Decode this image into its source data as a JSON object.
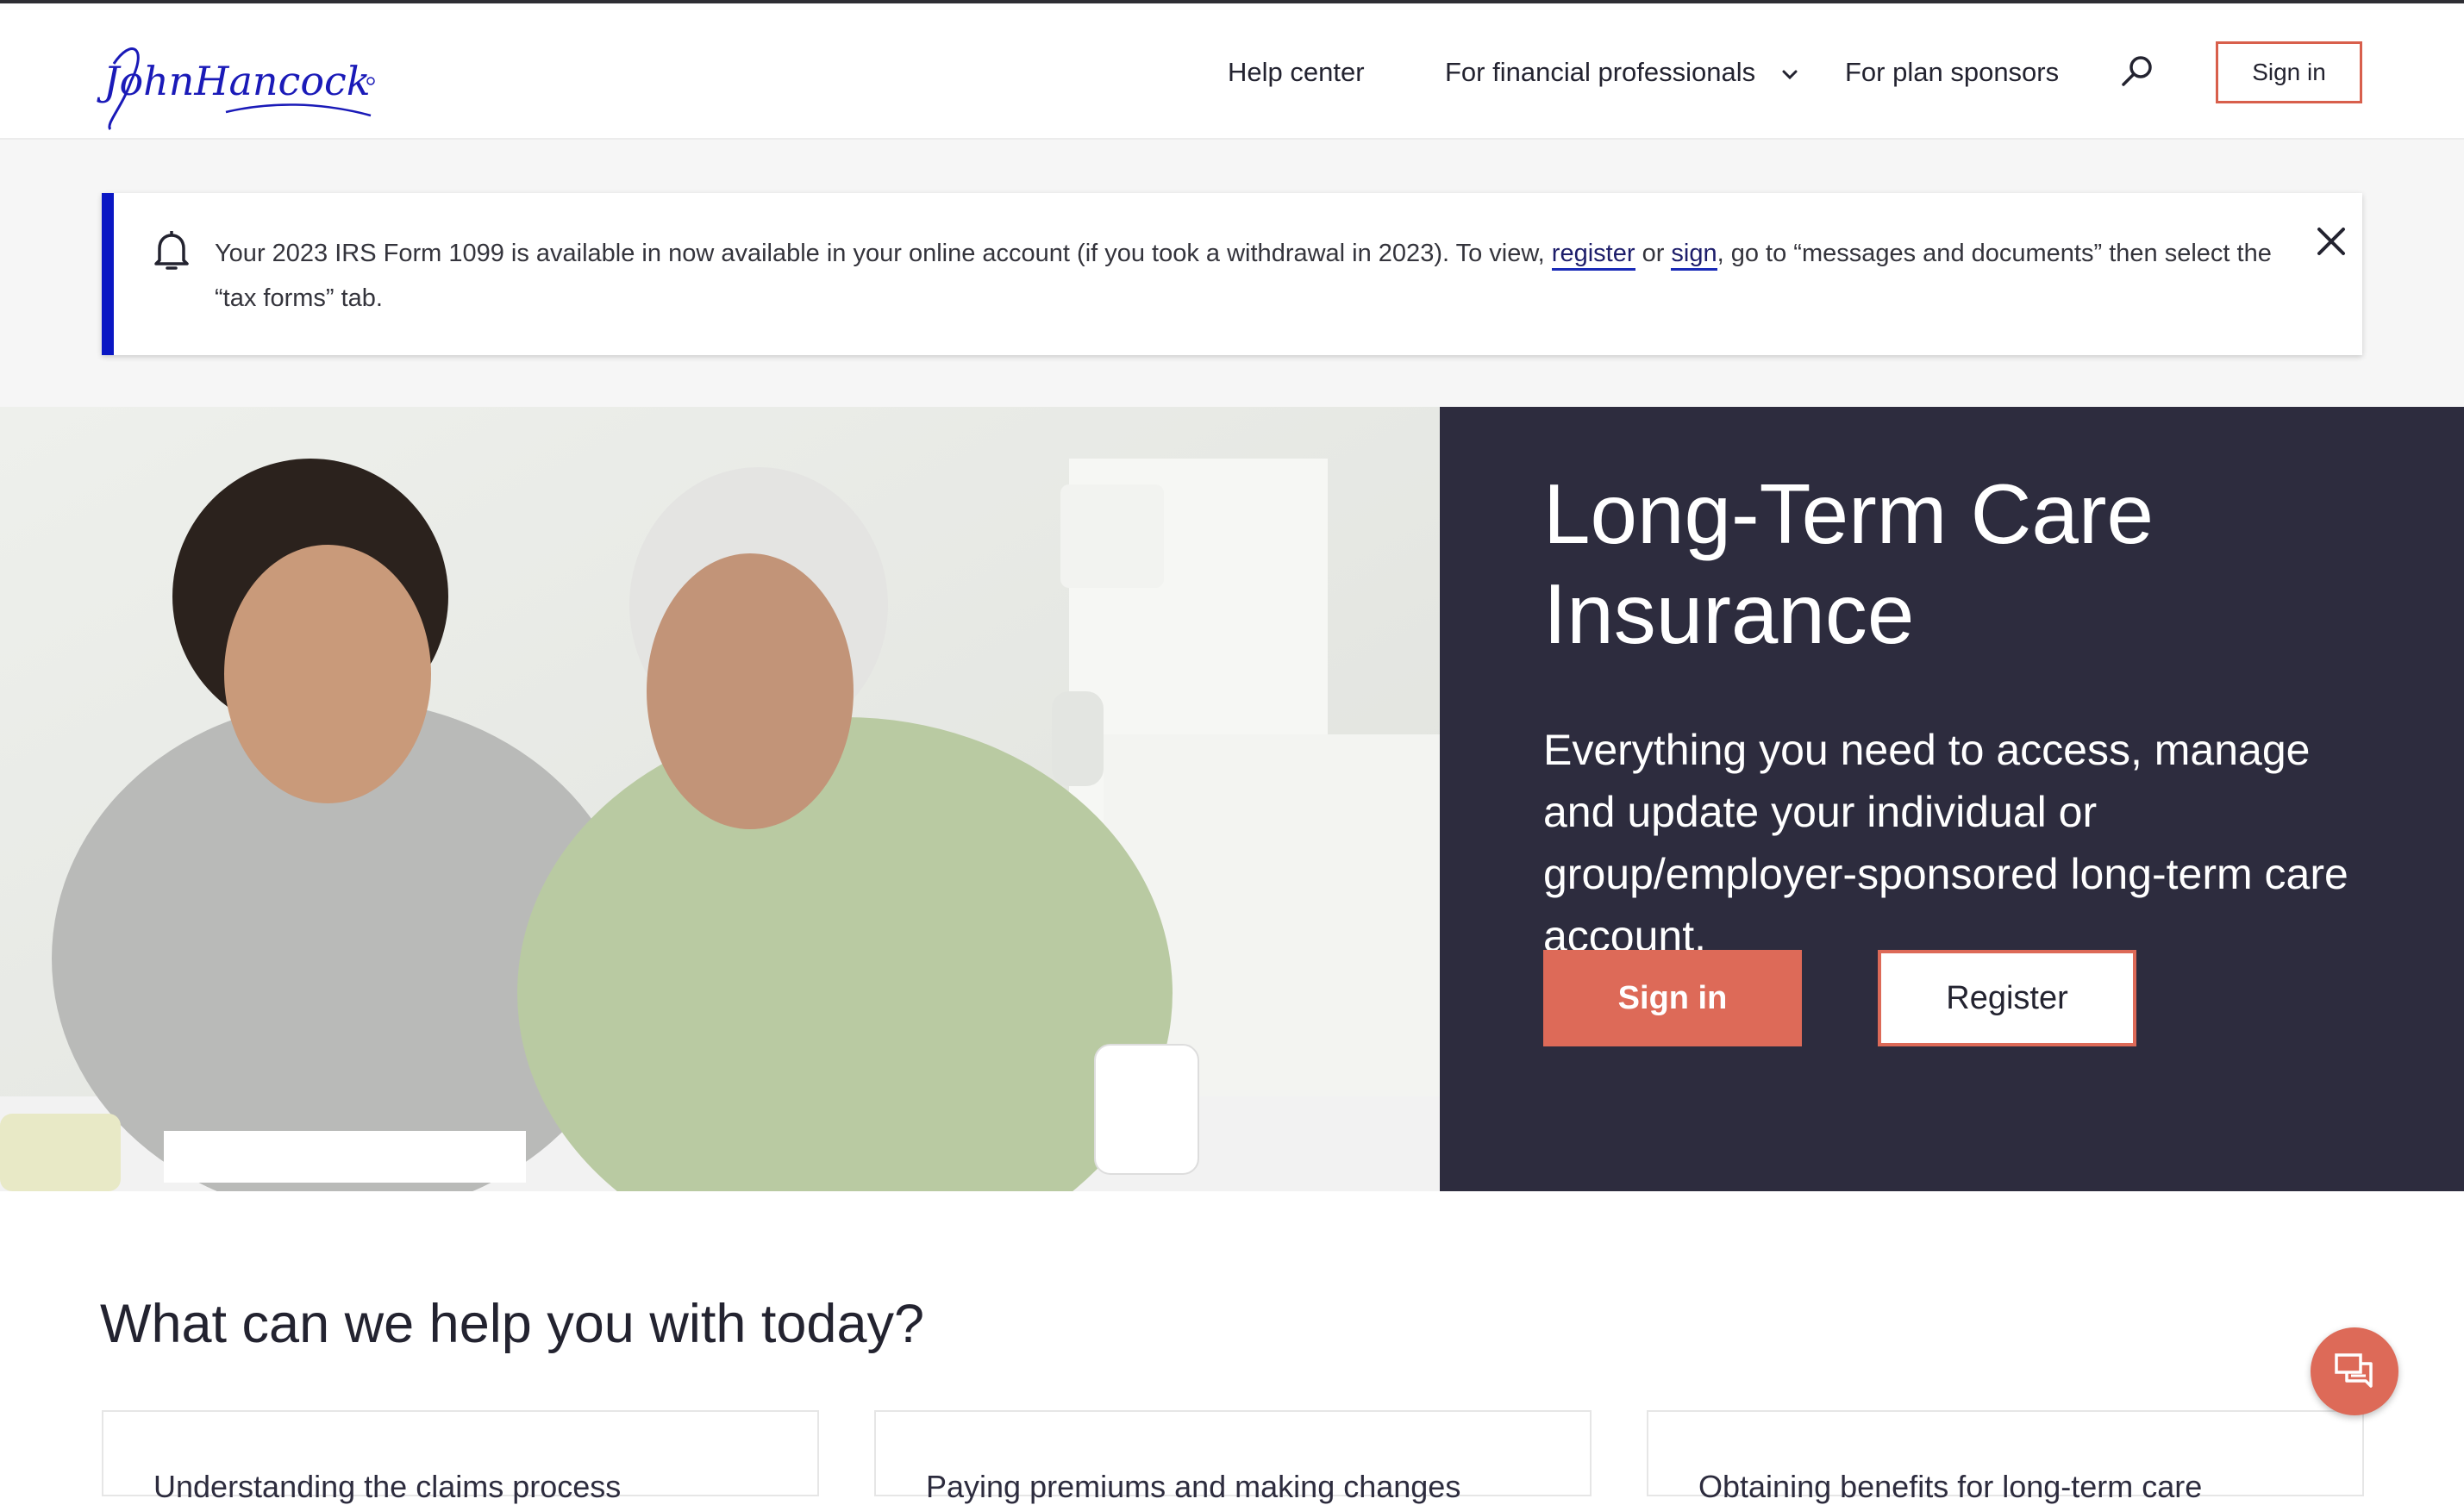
{
  "brand": {
    "logo_text": "John Hancock"
  },
  "header": {
    "nav": [
      {
        "label": "Help center"
      },
      {
        "label": "For financial professionals"
      },
      {
        "label": "For plan sponsors"
      }
    ],
    "search_icon": "search-icon",
    "signin_label": "Sign in"
  },
  "alert": {
    "icon": "bell-icon",
    "text_before": "Your 2023 IRS Form 1099 is available in now available in your online account (if you took a withdrawal in 2023). To view,",
    "link_register": "register",
    "text_or": "or",
    "link_sign": "sign",
    "text_after": ", go to “messages and documents” then select the “tax forms” tab.",
    "close_icon": "close-icon"
  },
  "hero": {
    "title": "Long-Term Care Insurance",
    "subtitle": "Everything you need to access, manage and update your individual or group/employer-sponsored long-term care account.",
    "signin_label": "Sign in",
    "register_label": "Register"
  },
  "help": {
    "heading": "What can we help you with today?",
    "cards": [
      {
        "label": "Understanding the claims process"
      },
      {
        "label": "Paying premiums and making changes"
      },
      {
        "label": "Obtaining benefits for long-term care"
      }
    ]
  },
  "colors": {
    "accent": "#dd6a58",
    "navy_panel": "#2d2c3e",
    "alert_bar": "#0a17c4",
    "logo_blue": "#1a1ab8"
  },
  "chat": {
    "icon": "chat-icon"
  }
}
